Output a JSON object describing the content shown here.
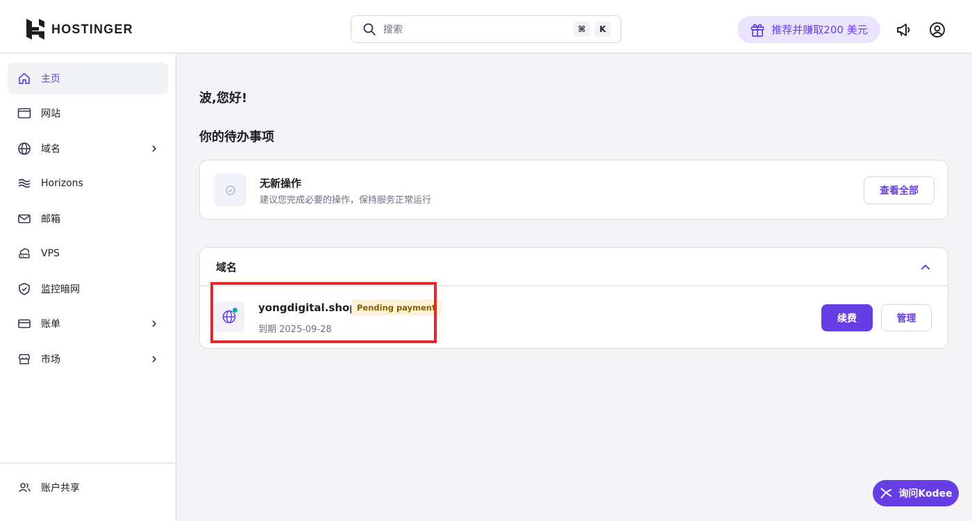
{
  "brand": {
    "name": "HOSTINGER",
    "accent": "#673de6"
  },
  "header": {
    "search_placeholder": "搜索",
    "shortcut_keys": [
      "⌘",
      "K"
    ],
    "referral_label": "推荐并赚取200 美元",
    "icons": [
      "gift-icon",
      "megaphone-icon",
      "account-icon"
    ]
  },
  "sidebar": {
    "items": [
      {
        "label": "主页",
        "icon": "home-icon",
        "active": true,
        "expandable": false
      },
      {
        "label": "网站",
        "icon": "website-icon",
        "active": false,
        "expandable": false
      },
      {
        "label": "域名",
        "icon": "globe-icon",
        "active": false,
        "expandable": true
      },
      {
        "label": "Horizons",
        "icon": "horizons-icon",
        "active": false,
        "expandable": false
      },
      {
        "label": "邮箱",
        "icon": "mail-icon",
        "active": false,
        "expandable": false
      },
      {
        "label": "VPS",
        "icon": "vps-icon",
        "active": false,
        "expandable": false
      },
      {
        "label": "监控暗网",
        "icon": "shield-icon",
        "active": false,
        "expandable": false
      },
      {
        "label": "账单",
        "icon": "card-icon",
        "active": false,
        "expandable": true
      },
      {
        "label": "市场",
        "icon": "store-icon",
        "active": false,
        "expandable": true
      }
    ],
    "footer_item": {
      "label": "账户共享",
      "icon": "users-icon"
    }
  },
  "main": {
    "greeting": "波,您好!",
    "todo_section_title": "你的待办事项",
    "todo_card": {
      "title": "无新操作",
      "subtitle": "建议您完成必要的操作，保持服务正常运行",
      "button_label": "查看全部"
    },
    "domain_card": {
      "title": "域名",
      "domain": "yongdigital.shop",
      "status_badge": "Pending payment",
      "expiry": "到期 2025-09-28",
      "renew_label": "续费",
      "manage_label": "管理"
    }
  },
  "assistant": {
    "label": "询问Kodee"
  }
}
